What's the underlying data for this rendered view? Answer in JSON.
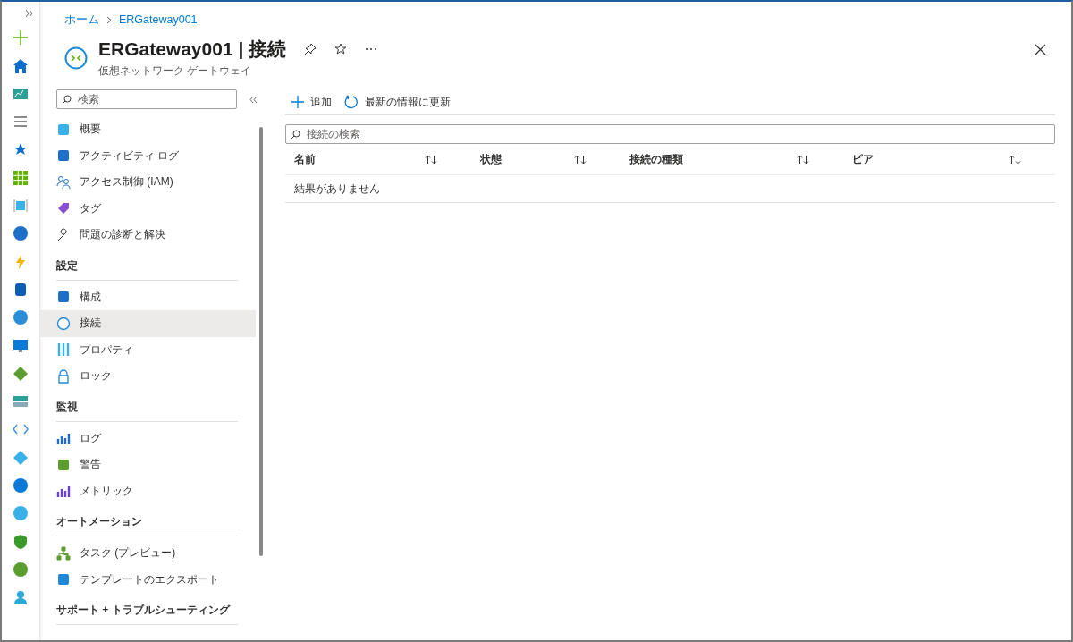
{
  "breadcrumb": [
    {
      "label": "ホーム"
    },
    {
      "label": "ERGateway001"
    }
  ],
  "title": "ERGateway001 | 接続",
  "subtitle": "仮想ネットワーク ゲートウェイ",
  "menu": {
    "search": {
      "placeholder": "検索"
    },
    "groups": [
      {
        "items": [
          {
            "label": "概要",
            "selected": false
          },
          {
            "label": "アクティビティ ログ",
            "selected": false
          },
          {
            "label": "アクセス制御 (IAM)",
            "selected": false
          },
          {
            "label": "タグ",
            "selected": false
          },
          {
            "label": "問題の診断と解決",
            "selected": false
          }
        ]
      },
      {
        "heading": "設定",
        "items": [
          {
            "label": "構成",
            "selected": false
          },
          {
            "label": "接続",
            "selected": true
          },
          {
            "label": "プロパティ",
            "selected": false
          },
          {
            "label": "ロック",
            "selected": false
          }
        ]
      },
      {
        "heading": "監視",
        "items": [
          {
            "label": "ログ",
            "selected": false
          },
          {
            "label": "警告",
            "selected": false
          },
          {
            "label": "メトリック",
            "selected": false
          }
        ]
      },
      {
        "heading": "オートメーション",
        "items": [
          {
            "label": "タスク (プレビュー)",
            "selected": false
          },
          {
            "label": "テンプレートのエクスポート",
            "selected": false
          }
        ]
      },
      {
        "heading": "サポート + トラブルシューティング"
      }
    ]
  },
  "toolbar": [
    {
      "kind": "add",
      "label": "追加"
    },
    {
      "kind": "refresh",
      "label": "最新の情報に更新"
    }
  ],
  "table": {
    "search": {
      "placeholder": "接続の検索"
    },
    "columns": [
      "名前",
      "状態",
      "接続の種類",
      "ピア"
    ],
    "empty_message": "結果がありません"
  }
}
